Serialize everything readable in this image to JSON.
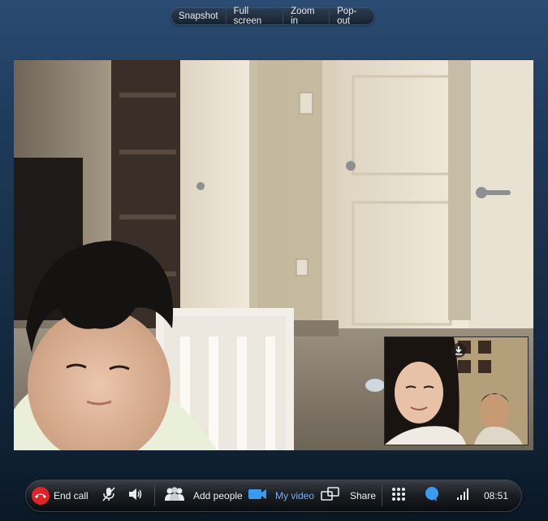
{
  "video_toolbar": {
    "snapshot": "Snapshot",
    "full_screen": "Full screen",
    "zoom_in": "Zoom in",
    "pop_out": "Pop-out"
  },
  "call_controls": {
    "end_call": "End call",
    "add_people": "Add people",
    "my_video": "My video",
    "share": "Share",
    "time": "08:51"
  },
  "icons": {
    "end_call": "phone-hangup-icon",
    "mute": "microphone-muted-icon",
    "volume": "speaker-icon",
    "add_people": "add-people-icon",
    "my_video": "video-camera-icon",
    "share": "share-screen-icon",
    "dialpad": "dialpad-icon",
    "chat": "chat-bubble-icon",
    "signal": "signal-strength-icon",
    "self_view_save": "download-icon"
  },
  "colors": {
    "end_call_red": "#e0232a",
    "active_blue": "#3a9cf0",
    "background_top": "#2a4c73",
    "background_bottom": "#0b1826"
  }
}
